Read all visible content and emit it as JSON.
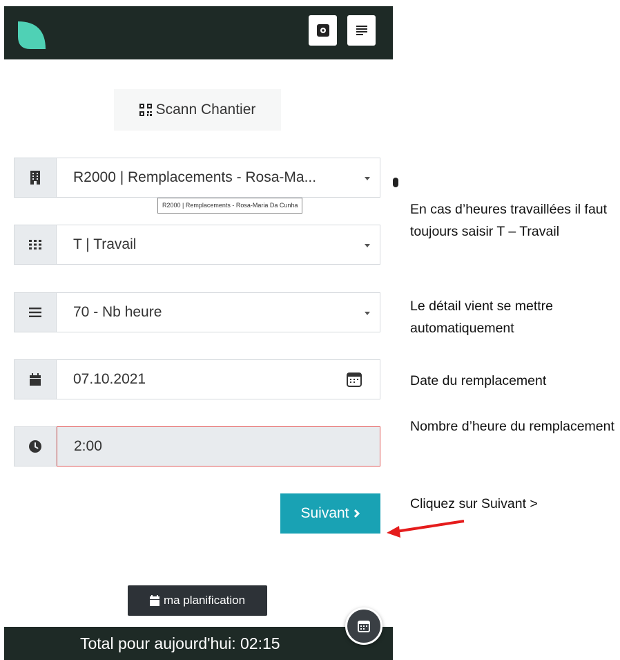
{
  "header": {
    "settings_icon": "gear-icon",
    "menu_icon": "list-icon"
  },
  "scan": {
    "label": "Scann Chantier",
    "icon": "qr-code-icon"
  },
  "fields": {
    "chantier": {
      "value": "R2000 | Remplacements - Rosa-Ma...",
      "tooltip": "R2000 | Remplacements - Rosa-Maria Da Cunha",
      "icon": "building-icon"
    },
    "type": {
      "value": "T | Travail",
      "icon": "grid-icon"
    },
    "detail": {
      "value": "70 - Nb heure",
      "icon": "bars-icon"
    },
    "date": {
      "value": "07.10.2021",
      "icon": "calendar-icon"
    },
    "hours": {
      "value": "2:00",
      "icon": "clock-icon"
    }
  },
  "buttons": {
    "next": "Suivant",
    "planning": "ma planification"
  },
  "footer": {
    "total": "Total pour aujourd'hui: 02:15"
  },
  "notes": {
    "n1": "En cas d’heures travaillées il faut toujours saisir T – Travail",
    "n2": "Le détail vient se mettre automatiquement",
    "n3": "Date du remplacement",
    "n4": "Nombre d’heure du remplacement",
    "n5": "Cliquez sur Suivant >"
  },
  "colors": {
    "topbar": "#1e2a26",
    "accent": "#19a2b4",
    "logo": "#4fd1b5",
    "error": "#e05a5a",
    "arrow": "#e51c1c"
  }
}
